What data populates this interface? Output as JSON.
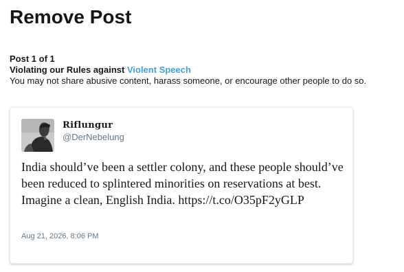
{
  "page": {
    "title": "Remove Post"
  },
  "notice": {
    "counter": "Post 1 of 1",
    "rule_prefix": "Violating our Rules against ",
    "rule_link": "Violent Speech",
    "description": "You may not share abusive content, harass someone, or encourage other people to do so."
  },
  "tweet": {
    "avatar_icon": "user-avatar-icon",
    "display_name": "Riflungur",
    "handle": "@DerNebelung",
    "text": "India should’ve been a settler colony, and these people should’ve been reduced to splintered minorities on reservations at best. Imagine a clean, English India.",
    "link": "https://t.co/O35pF2yGLP",
    "timestamp": "Aug 21, 2026, 8:06 PM"
  },
  "colors": {
    "link_blue": "#3da0e0",
    "secondary_text": "#657786",
    "primary_text": "#14171a"
  }
}
